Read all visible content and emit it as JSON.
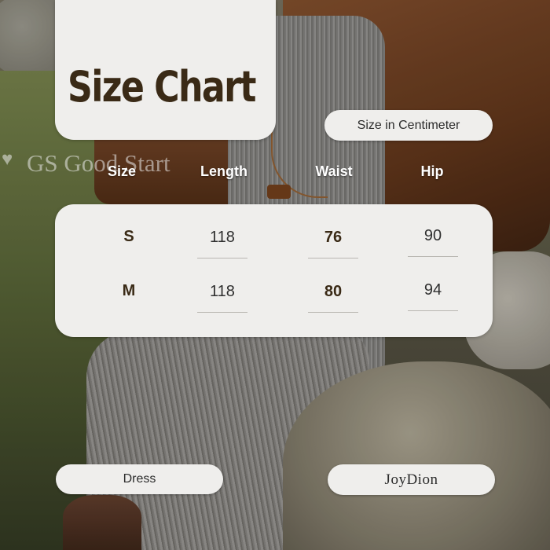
{
  "title": "Size Chart",
  "unit_label": "Size in Centimeter",
  "watermark": "GS Good Start",
  "columns": [
    "Size",
    "Length",
    "Waist",
    "Hip"
  ],
  "rows": [
    {
      "size": "S",
      "length": "118",
      "waist": "76",
      "hip": "90"
    },
    {
      "size": "M",
      "length": "118",
      "waist": "80",
      "hip": "94"
    }
  ],
  "category": "Dress",
  "brand": "JoyDion"
}
